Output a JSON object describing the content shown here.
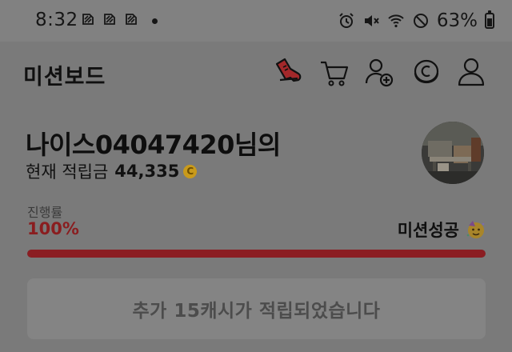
{
  "status_bar": {
    "time": "8:32",
    "battery_percent": "63%",
    "notification_icons": [
      "sync-icon",
      "sync-icon",
      "sync-icon"
    ],
    "system_icons": [
      "alarm-icon",
      "mute-icon",
      "wifi-icon",
      "do-not-disturb-icon",
      "battery-icon"
    ]
  },
  "header": {
    "title": "미션보드",
    "icons": [
      "sneaker-icon",
      "cart-icon",
      "add-friend-icon",
      "coin-icon",
      "profile-icon"
    ]
  },
  "greeting": {
    "name_line": "나이스04047420님의",
    "points_label": "현재 적립금",
    "points_value": "44,335",
    "coin_symbol": "C"
  },
  "progress": {
    "label": "진행률",
    "percent_text": "100%",
    "fraction": 1.0,
    "status_text": "미션성공"
  },
  "reward": {
    "button_text": "추가 15캐시가 적립되었습니다"
  },
  "colors": {
    "accent_red": "#8b1d22",
    "coin_gold": "#c99a1b"
  }
}
